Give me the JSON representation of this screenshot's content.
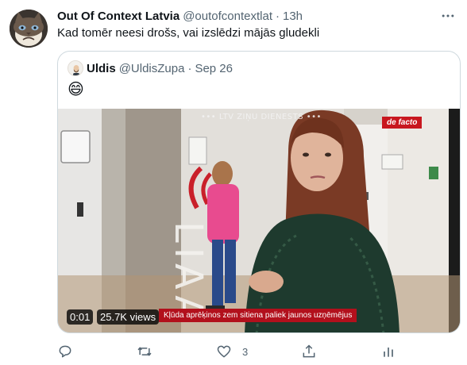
{
  "tweet": {
    "author": {
      "display_name": "Out Of Context Latvia",
      "handle": "@outofcontextlat",
      "avatar_icon": "grumpy-cat-avatar"
    },
    "separator": "·",
    "time": "13h",
    "text": "Kad tomēr neesi drošs, vai izslēdzi mājās gludekli",
    "more_icon": "ellipsis-icon"
  },
  "quoted_tweet": {
    "author": {
      "display_name": "Uldis",
      "handle": "@UldisZupa",
      "avatar_icon": "bearded-man-avatar"
    },
    "separator": "·",
    "date": "Sep 26",
    "text": "😄",
    "video": {
      "watermark": "••• LTV ZIŅU DIENESTS •••",
      "brand": "de facto",
      "ticker": "Kļūda aprēķinos zem sitiena paliek jaunos uzņēmējus",
      "timestamp": "0:01",
      "views": "25.7K views"
    }
  },
  "actions": {
    "reply_icon": "reply-icon",
    "retweet_icon": "retweet-icon",
    "like_icon": "heart-icon",
    "like_count": "3",
    "share_icon": "share-icon",
    "analytics_icon": "analytics-icon"
  },
  "colors": {
    "text_primary": "#0f1419",
    "text_secondary": "#536471",
    "border": "#cfd9de",
    "ticker_red": "#b2101c"
  }
}
